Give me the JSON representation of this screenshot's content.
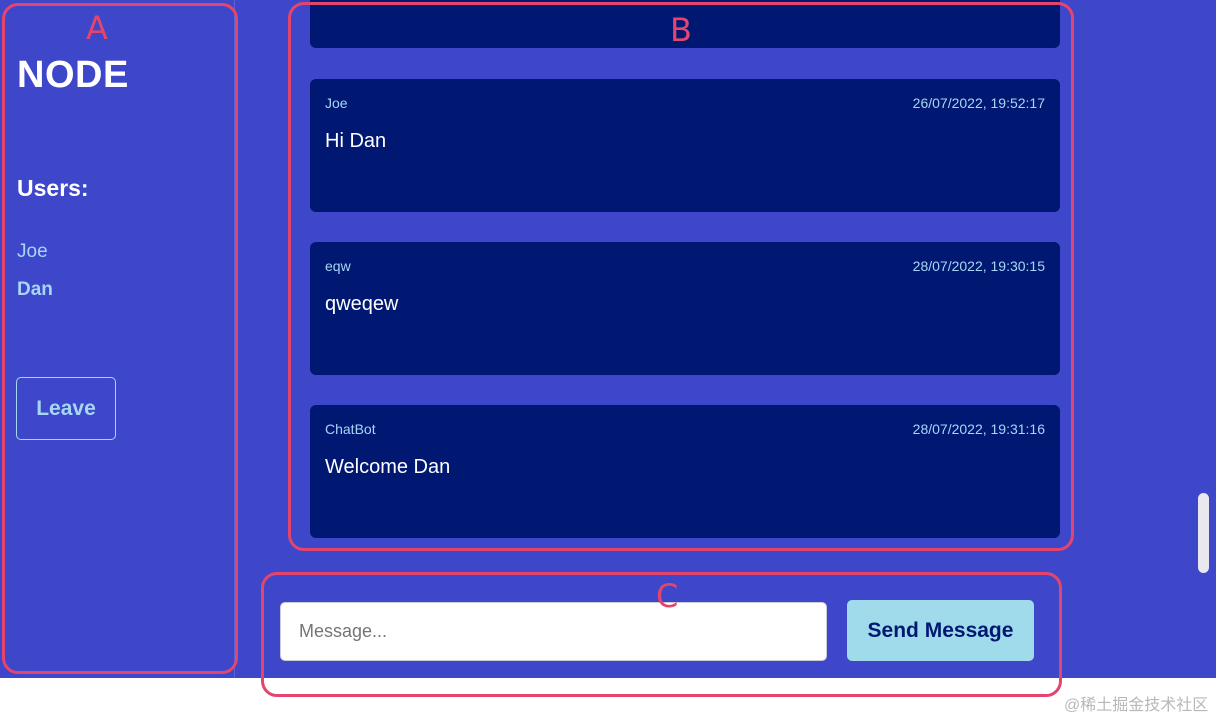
{
  "sidebar": {
    "room_title": "NODE",
    "users_heading": "Users:",
    "users": [
      "Joe",
      "Dan"
    ],
    "leave_label": "Leave"
  },
  "messages": [
    {
      "user": "Joe",
      "time": "26/07/2022, 19:52:17",
      "text": "Hi Dan"
    },
    {
      "user": "eqw",
      "time": "28/07/2022, 19:30:15",
      "text": "qweqew"
    },
    {
      "user": "ChatBot",
      "time": "28/07/2022, 19:31:16",
      "text": "Welcome Dan"
    }
  ],
  "composer": {
    "placeholder": "Message...",
    "value": "",
    "send_label": "Send Message"
  },
  "annotations": {
    "a": "A",
    "b": "B",
    "c": "C"
  },
  "watermark": "@稀土掘金技术社区",
  "colors": {
    "background": "#3e47c9",
    "message_bg": "#001872",
    "accent_light": "#a7d6f5",
    "button_bg": "#9fdbea",
    "annotation": "#e4456d"
  }
}
